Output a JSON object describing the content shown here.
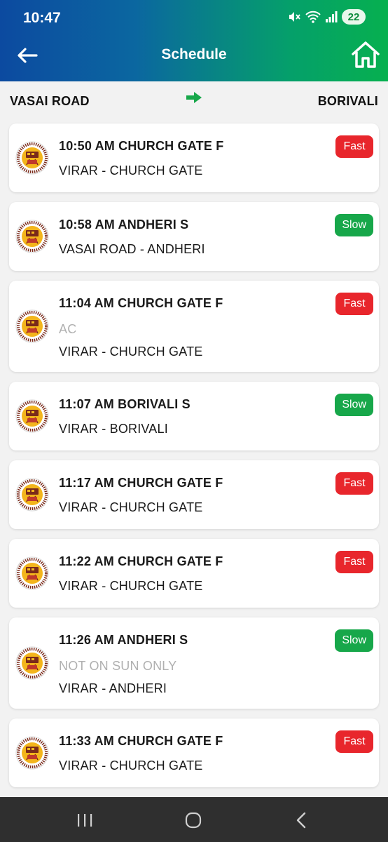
{
  "status_bar": {
    "time": "10:47",
    "battery": "22"
  },
  "header": {
    "title": "Schedule"
  },
  "route": {
    "from": "VASAI ROAD",
    "to": "BORIVALI"
  },
  "colors": {
    "fast": "#e8262c",
    "slow": "#17a74a",
    "accent": "#17a74a"
  },
  "trains": [
    {
      "name": "10:50 AM CHURCH GATE F",
      "note": "",
      "route": "VIRAR - CHURCH GATE",
      "speed": "Fast"
    },
    {
      "name": "10:58 AM ANDHERI S",
      "note": "",
      "route": "VASAI ROAD - ANDHERI",
      "speed": "Slow"
    },
    {
      "name": "11:04 AM CHURCH GATE F",
      "note": "AC",
      "route": "VIRAR - CHURCH GATE",
      "speed": "Fast"
    },
    {
      "name": "11:07 AM BORIVALI S",
      "note": "",
      "route": "VIRAR - BORIVALI",
      "speed": "Slow"
    },
    {
      "name": "11:17 AM CHURCH GATE F",
      "note": "",
      "route": "VIRAR - CHURCH GATE",
      "speed": "Fast"
    },
    {
      "name": "11:22 AM CHURCH GATE F",
      "note": "",
      "route": "VIRAR - CHURCH GATE",
      "speed": "Fast"
    },
    {
      "name": "11:26 AM ANDHERI S",
      "note": "NOT ON SUN ONLY",
      "route": "VIRAR - ANDHERI",
      "speed": "Slow"
    },
    {
      "name": "11:33 AM CHURCH GATE F",
      "note": "",
      "route": "VIRAR - CHURCH GATE",
      "speed": "Fast"
    }
  ],
  "icons": {
    "back": "back-arrow-icon",
    "home": "home-icon",
    "route_arrow": "arrow-right-icon",
    "logo": "uts-logo-icon",
    "nav": [
      "recent-apps-icon",
      "home-circle-icon",
      "back-chevron-icon"
    ]
  }
}
